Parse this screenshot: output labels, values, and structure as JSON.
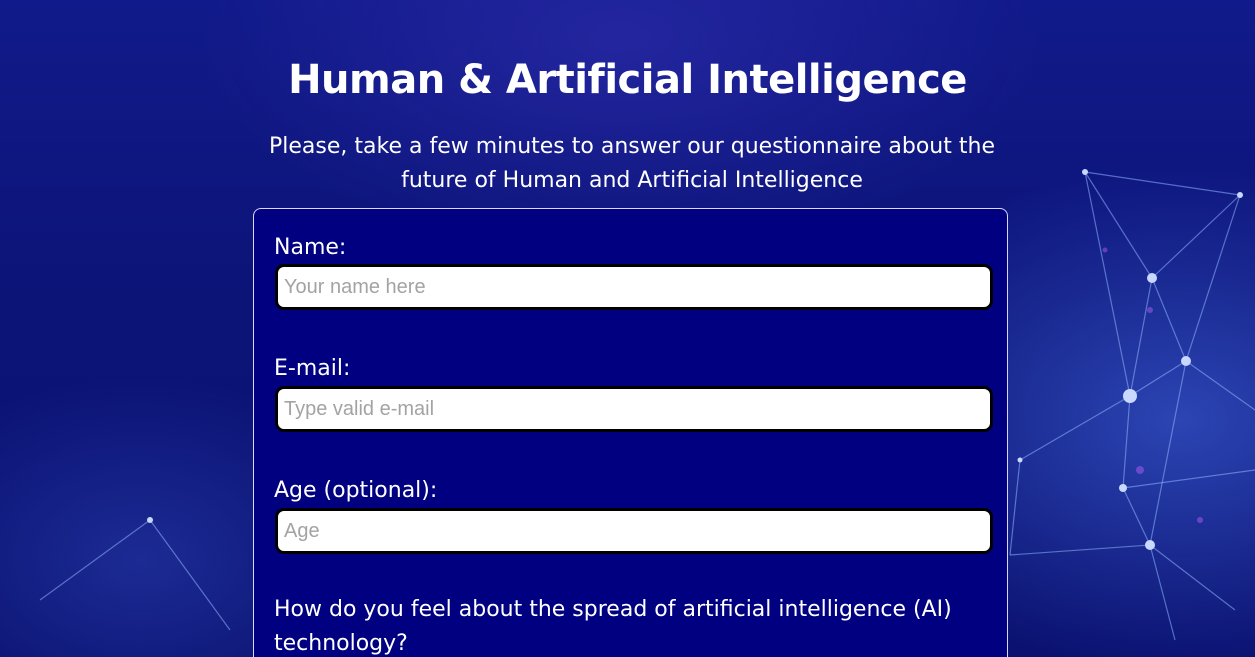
{
  "header": {
    "title": "Human & Artificial Intelligence",
    "subtitle": "Please, take a few minutes to answer our questionnaire about the future of Human and Artificial Intelligence"
  },
  "form": {
    "name": {
      "label": "Name:",
      "placeholder": "Your name here",
      "value": ""
    },
    "email": {
      "label": "E-mail:",
      "placeholder": "Type valid e-mail",
      "value": ""
    },
    "age": {
      "label": "Age (optional):",
      "placeholder": "Age",
      "value": ""
    },
    "question_1": "How do you feel about the spread of artificial intelligence (AI) technology?"
  },
  "colors": {
    "background": "#0c1478",
    "card_background": "#000080",
    "card_border": "#d8d8ff",
    "text": "#ffffff",
    "input_border": "#000000",
    "placeholder": "#a3a3a3"
  },
  "icons": {
    "background": "network-graph-background"
  }
}
